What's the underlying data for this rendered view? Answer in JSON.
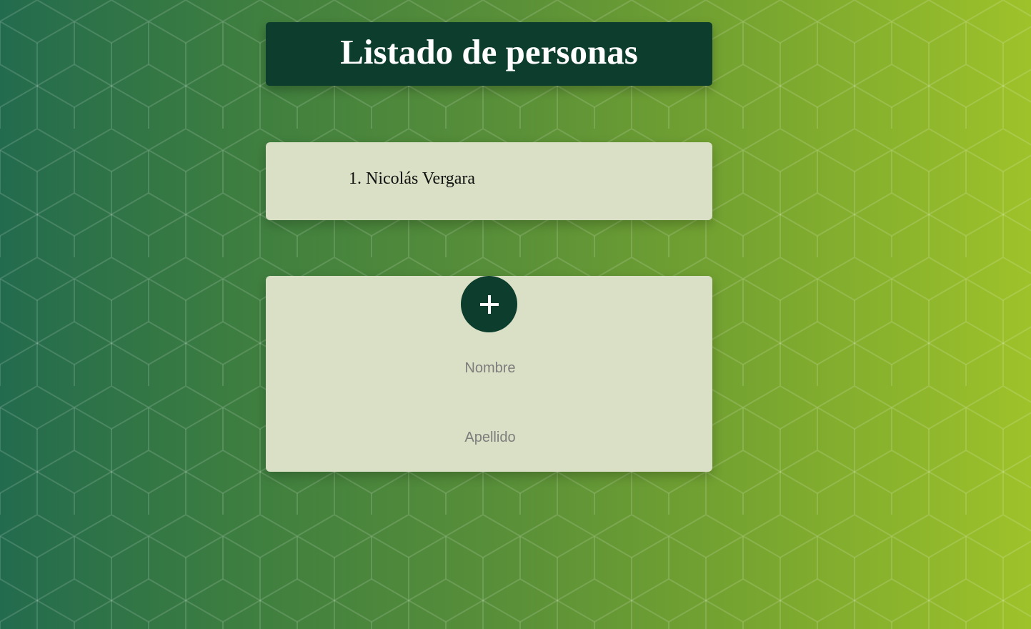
{
  "header": {
    "title": "Listado de personas"
  },
  "people": [
    {
      "index": "1.",
      "name": "Nicolás Vergara"
    }
  ],
  "form": {
    "add_icon": "plus-icon",
    "nombre": {
      "value": "",
      "placeholder": "Nombre"
    },
    "apellido": {
      "value": "",
      "placeholder": "Apellido"
    }
  },
  "colors": {
    "header_bg": "#0d3d2c",
    "card_bg": "#dae0c5",
    "gradient_start": "#236b4e",
    "gradient_end": "#9ec22a"
  }
}
